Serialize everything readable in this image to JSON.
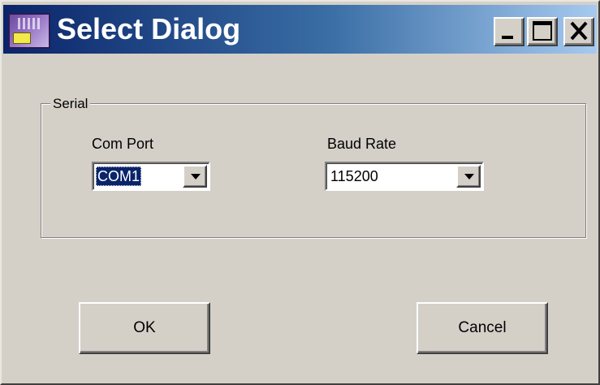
{
  "window": {
    "title": "Select Dialog"
  },
  "caption_buttons": {
    "minimize_icon": "minimize-icon",
    "maximize_icon": "maximize-icon",
    "close_icon": "close-icon"
  },
  "serial_group": {
    "label": "Serial",
    "com_port": {
      "label": "Com Port",
      "value": "COM1"
    },
    "baud_rate": {
      "label": "Baud Rate",
      "value": "115200"
    }
  },
  "buttons": {
    "ok_label": "OK",
    "cancel_label": "Cancel"
  },
  "colors": {
    "titlebar_start": "#0a246a",
    "titlebar_end": "#a6caf0",
    "face": "#d4d0c8",
    "selection": "#0a246a"
  }
}
